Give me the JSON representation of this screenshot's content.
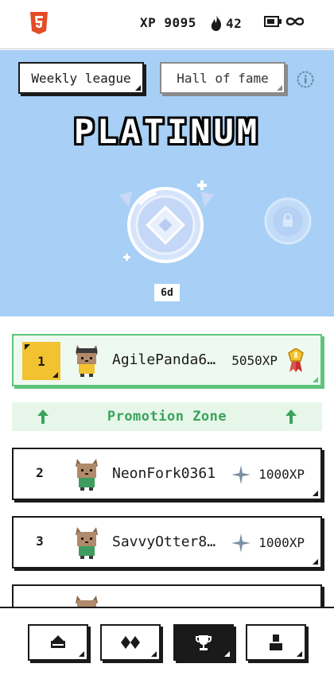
{
  "status": {
    "logo_icon": "html5-icon",
    "xp_label": "XP 9095",
    "streak_count": "42",
    "streak_icon": "flame-icon",
    "battery_icon": "battery-icon",
    "lives_icon": "infinity-icon"
  },
  "league": {
    "tabs": [
      {
        "label": "Weekly league",
        "active": true
      },
      {
        "label": "Hall of fame",
        "active": false
      }
    ],
    "info_icon": "info-icon",
    "title": "PLATINUM",
    "time_left": "6d",
    "badge_icon": "platinum-badge-icon",
    "next_badge_icon": "locked-badge-icon",
    "colors": {
      "hero_bg": "#a8cff5",
      "promo_bg": "#e6f7ea",
      "promo_text": "#3aa35b",
      "gold": "#f2c230"
    }
  },
  "leaderboard": {
    "rows": [
      {
        "rank": "1",
        "name": "AgilePanda6…",
        "xp": "5050XP",
        "highlight": true,
        "trailing_icon": "medal-icon"
      },
      {
        "rank": "2",
        "name": "NeonFork0361",
        "xp": "1000XP",
        "highlight": false,
        "trailing_icon": "spark-icon"
      },
      {
        "rank": "3",
        "name": "SavvyOtter8…",
        "xp": "1000XP",
        "highlight": false,
        "trailing_icon": "spark-icon"
      }
    ],
    "promotion_label": "Promotion Zone"
  },
  "nav": {
    "items": [
      {
        "name": "home",
        "icon": "home-icon",
        "active": false
      },
      {
        "name": "practice",
        "icon": "diamonds-icon",
        "active": false
      },
      {
        "name": "leagues",
        "icon": "trophy-icon",
        "active": true
      },
      {
        "name": "profile",
        "icon": "profile-icon",
        "active": false
      }
    ]
  }
}
